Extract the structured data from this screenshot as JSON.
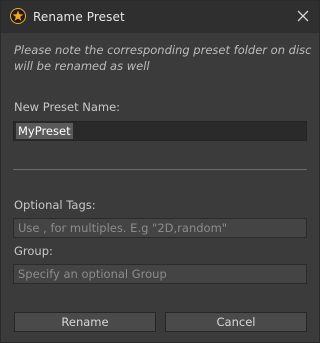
{
  "window": {
    "title": "Rename Preset",
    "icon": "app-star-icon",
    "close_icon": "close-icon"
  },
  "note": {
    "text": "Please note the corresponding preset folder on disc will be renamed as well"
  },
  "new_name": {
    "label": "New Preset Name:",
    "value": "MyPreset"
  },
  "tags": {
    "label": "Optional Tags:",
    "value": "",
    "placeholder": "Use , for multiples. E.g \"2D,random\""
  },
  "group": {
    "label": "Group:",
    "value": "",
    "placeholder": "Specify an optional Group"
  },
  "buttons": {
    "rename": "Rename",
    "cancel": "Cancel"
  },
  "colors": {
    "background": "#3b3b3b",
    "titlebar": "#2f2f2f",
    "accent": "#f5a623"
  }
}
